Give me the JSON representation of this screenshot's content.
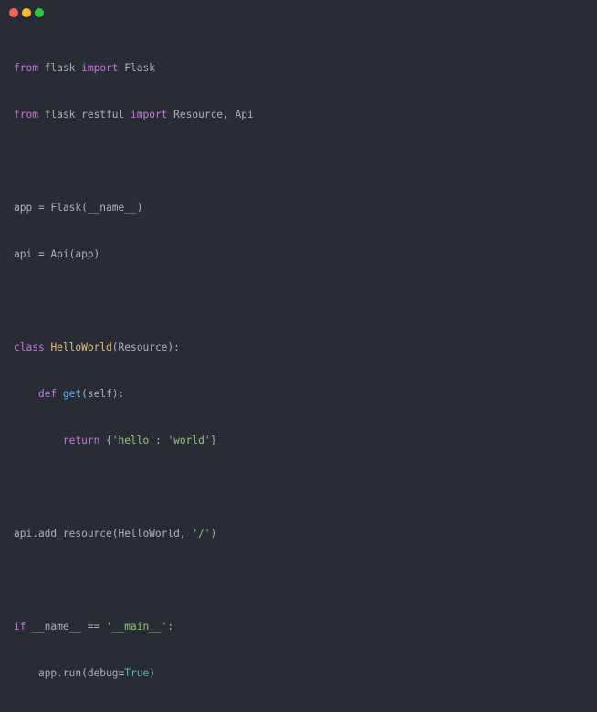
{
  "window": {
    "controls": {
      "close_color": "#ff5f56",
      "minimize_color": "#ffbd2e",
      "maximize_color": "#27c93f"
    }
  },
  "code": {
    "l1": {
      "kw1": "from",
      "mod": " flask ",
      "kw2": "import",
      "name": " Flask"
    },
    "l2": {
      "kw1": "from",
      "mod": " flask_restful ",
      "kw2": "import",
      "name": " Resource, Api"
    },
    "l3": {
      "text": "app = Flask(__name__)"
    },
    "l4": {
      "text": "api = Api(app)"
    },
    "l5": {
      "kw": "class",
      "sp": " ",
      "cls": "HelloWorld",
      "rest": "(Resource):"
    },
    "l6": {
      "indent": "    ",
      "kw": "def",
      "sp": " ",
      "fn": "get",
      "rest": "(self):"
    },
    "l7": {
      "indent": "        ",
      "kw": "return",
      "p1": " {",
      "s1": "'hello'",
      "p2": ": ",
      "s2": "'world'",
      "p3": "}"
    },
    "l8": {
      "pre": "api.add_resource(HelloWorld, ",
      "s": "'/'",
      "post": ")"
    },
    "l9": {
      "kw": "if",
      "pre": " __name__ == ",
      "s": "'__main__'",
      "post": ":"
    },
    "l10": {
      "indent": "    ",
      "pre": "app.run(debug=",
      "bool": "True",
      "post": ")"
    }
  }
}
